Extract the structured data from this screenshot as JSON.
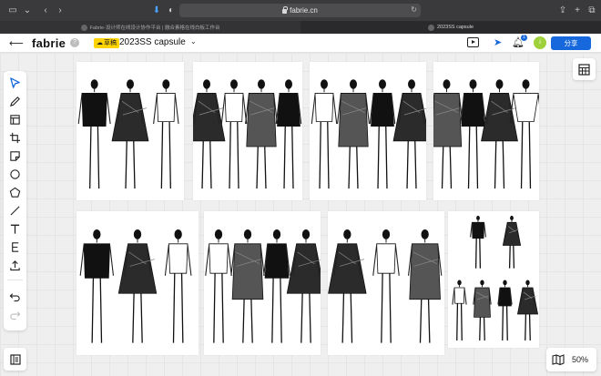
{
  "browser": {
    "url": "fabrie.cn",
    "tabs": [
      {
        "label": "Fabrie-设计师在线设计协作平台 | 融合素格在线白板工作台"
      },
      {
        "label": "2023SS capsule"
      }
    ]
  },
  "header": {
    "logo": "fabrie",
    "help": "?",
    "draft_label": "草稿",
    "project_title": "2023SS capsule",
    "notification_count": "1",
    "avatar_initial": "i",
    "share_label": "分享"
  },
  "toolbar": {
    "tools": [
      "select-tool",
      "pen-tool",
      "frame-tool",
      "crop-tool",
      "sticky-note-tool",
      "circle-tool",
      "polygon-tool",
      "line-tool",
      "text-tool",
      "connector-tool",
      "upload-tool",
      "undo",
      "redo"
    ]
  },
  "canvas": {
    "zoom": "50%",
    "cards": [
      {
        "name": "sketch-card-1",
        "figures": 3
      },
      {
        "name": "sketch-card-2",
        "figures": 4
      },
      {
        "name": "sketch-card-3",
        "figures": 4
      },
      {
        "name": "sketch-card-4",
        "figures": 4
      },
      {
        "name": "sketch-card-5",
        "figures": 3
      },
      {
        "name": "sketch-card-6",
        "figures": 4
      },
      {
        "name": "sketch-card-7",
        "figures": 3
      },
      {
        "name": "sketch-card-8",
        "figures": 6
      }
    ]
  },
  "colors": {
    "accent": "#1668dc",
    "draft_badge": "#ffd400",
    "avatar": "#9fd13a"
  }
}
